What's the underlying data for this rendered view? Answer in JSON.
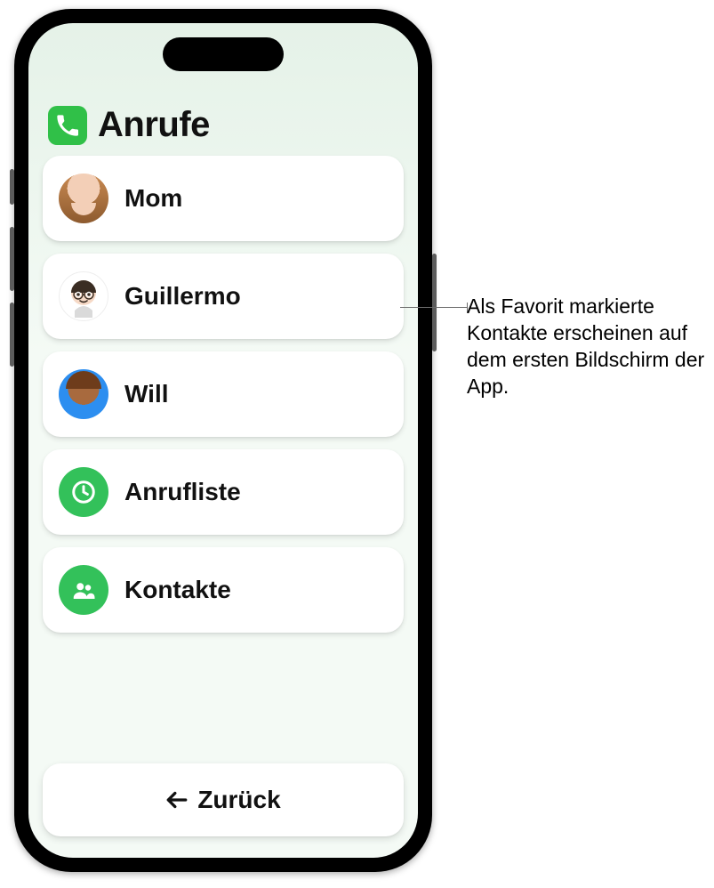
{
  "header": {
    "title": "Anrufe",
    "icon": "phone-icon"
  },
  "rows": [
    {
      "kind": "contact",
      "name": "Mom",
      "avatar": "av-mom"
    },
    {
      "kind": "contact",
      "name": "Guillermo",
      "avatar": "av-gui"
    },
    {
      "kind": "contact",
      "name": "Will",
      "avatar": "av-will"
    },
    {
      "kind": "action",
      "name": "Anrufliste",
      "icon": "clock-icon"
    },
    {
      "kind": "action",
      "name": "Kontakte",
      "icon": "people-icon"
    }
  ],
  "back_label": "Zurück",
  "callout": "Als Favorit markierte Kontakte erscheinen auf dem ersten Bildschirm der App."
}
